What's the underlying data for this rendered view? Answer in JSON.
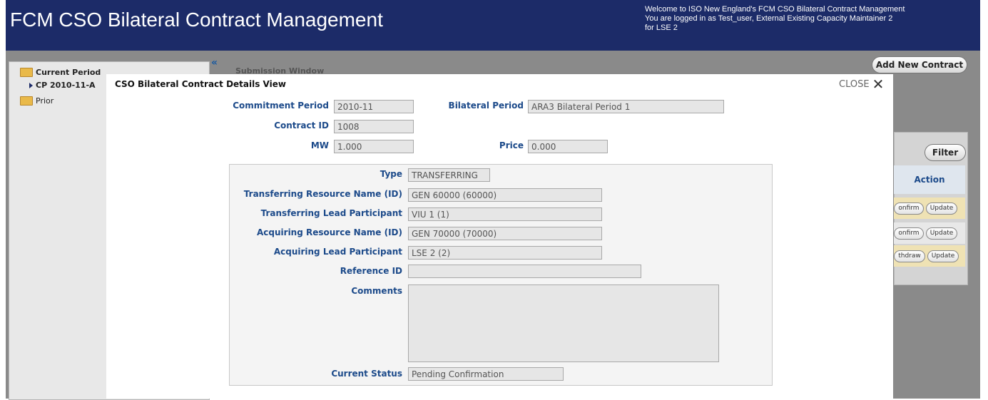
{
  "app": {
    "title": "FCM CSO Bilateral Contract Management",
    "welcome_line1": "Welcome to ISO New England's FCM CSO Bilateral Contract Management",
    "welcome_line2": "You are logged in as Test_user, External Existing Capacity Maintainer 2",
    "welcome_line3": "for LSE 2"
  },
  "sidebar": {
    "current_period": "Current Period",
    "current_child": "CP 2010-11-A",
    "prior": "Prior"
  },
  "background": {
    "collapse_glyph": "«",
    "submission_window": "Submission Window",
    "add_contract": "Add New Contract",
    "filter": "Filter",
    "action_header": "Action",
    "rows": [
      {
        "btn1": "onfirm",
        "btn2": "Update"
      },
      {
        "btn1": "onfirm",
        "btn2": "Update"
      },
      {
        "btn1": "thdraw",
        "btn2": "Update"
      }
    ]
  },
  "modal": {
    "title": "CSO Bilateral Contract Details View",
    "close": "CLOSE",
    "fields": {
      "commitment_period": {
        "label": "Commitment Period",
        "value": "2010-11"
      },
      "bilateral_period": {
        "label": "Bilateral Period",
        "value": "ARA3 Bilateral Period 1"
      },
      "contract_id": {
        "label": "Contract ID",
        "value": "1008"
      },
      "mw": {
        "label": "MW",
        "value": "1.000"
      },
      "price": {
        "label": "Price",
        "value": "0.000"
      },
      "type": {
        "label": "Type",
        "value": "TRANSFERRING"
      },
      "transferring_resource": {
        "label": "Transferring Resource Name (ID)",
        "value": "GEN 60000 (60000)"
      },
      "transferring_lead": {
        "label": "Transferring Lead Participant",
        "value": "VIU 1 (1)"
      },
      "acquiring_resource": {
        "label": "Acquiring Resource Name (ID)",
        "value": "GEN 70000 (70000)"
      },
      "acquiring_lead": {
        "label": "Acquiring Lead Participant",
        "value": "LSE 2 (2)"
      },
      "reference_id": {
        "label": "Reference ID",
        "value": ""
      },
      "comments": {
        "label": "Comments",
        "value": ""
      },
      "current_status": {
        "label": "Current Status",
        "value": "Pending Confirmation"
      }
    }
  },
  "colors": {
    "header_bg": "#1c2b68",
    "label_blue": "#1c4a8a",
    "row_highlight": "#efe2b4"
  }
}
